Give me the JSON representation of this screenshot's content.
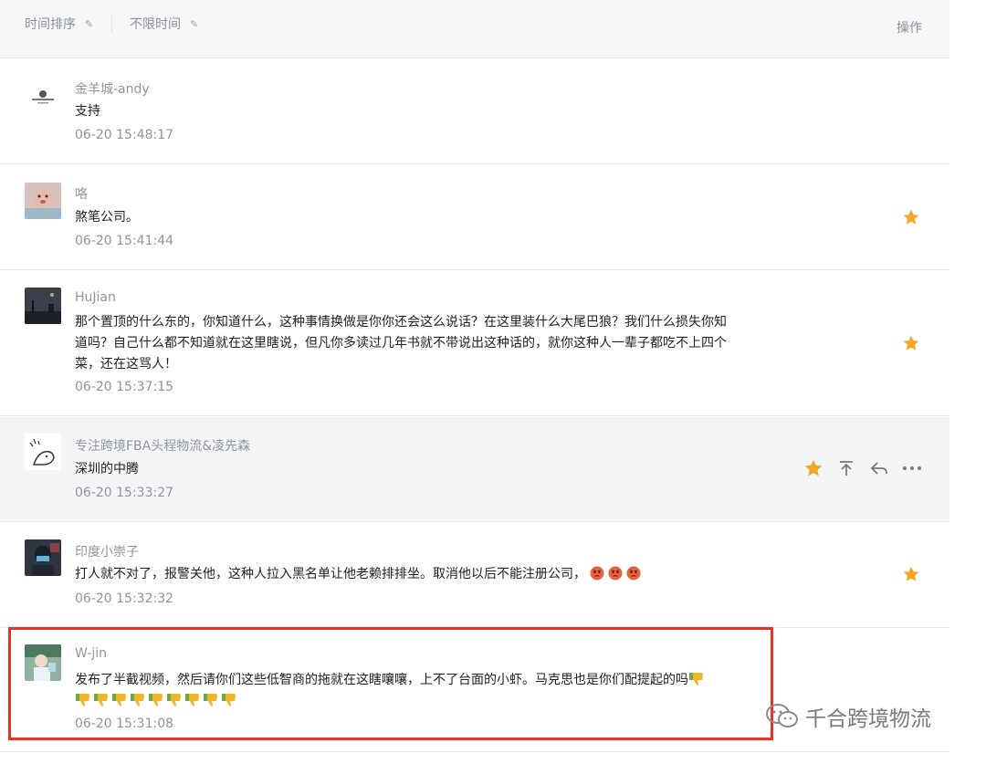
{
  "header": {
    "sort_label": "时间排序",
    "range_label": "不限时间",
    "ops_label": "操作"
  },
  "comments": [
    {
      "name": "金羊城-andy",
      "content": "支持",
      "time": "06-20 15:48:17",
      "starred": false
    },
    {
      "name": "咯",
      "content": "煞笔公司。",
      "time": "06-20 15:41:44",
      "starred": true
    },
    {
      "name": "HuJian",
      "content": "那个置顶的什么东的，你知道什么，这种事情换做是你你还会这么说话？在这里装什么大尾巴狼？我们什么损失你知道吗？自己什么都不知道就在这里瞎说，但凡你多读过几年书就不带说出这种话的，就你这种人一辈子都吃不上四个菜，还在这骂人！",
      "time": "06-20 15:37:15",
      "starred": true
    },
    {
      "name": "专注跨境FBA头程物流&凌先森",
      "content": "深圳的中腾",
      "time": "06-20 15:33:27",
      "starred": true
    },
    {
      "name": "印度小崇子",
      "content": "打人就不对了，报警关他，这种人拉入黑名单让他老赖排排坐。取消他以后不能注册公司，",
      "time": "06-20 15:32:32",
      "starred": true
    },
    {
      "name": "W-jin",
      "content": "发布了半截视频，然后请你们这些低智商的拖就在这瞎嚷嚷，上不了台面的小虾。马克思也是你们配提起的吗",
      "time": "06-20 15:31:08",
      "starred": false
    }
  ],
  "icons": {
    "star_color": "#f5a623",
    "highlight_color": "#e5332a",
    "emoji_angry": "angry-face-icon",
    "emoji_thumbs_down": "thumbs-down-icon"
  },
  "watermark": {
    "text": "千合跨境物流"
  }
}
